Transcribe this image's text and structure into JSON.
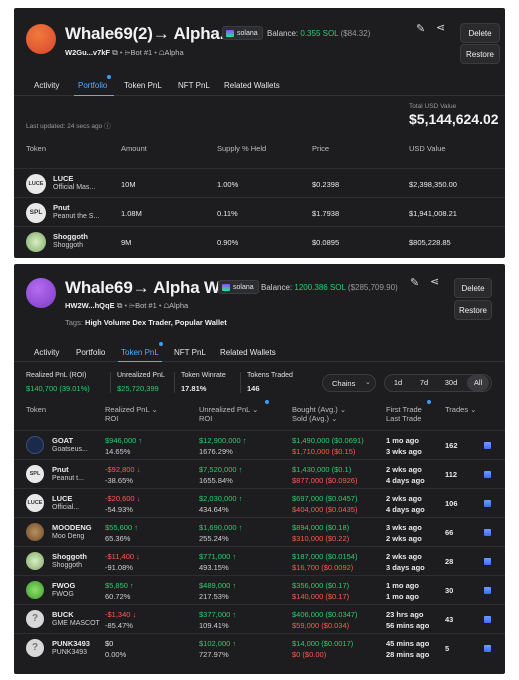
{
  "top": {
    "name": "Whale69(2)→ Alpha...",
    "chain": "solana",
    "balance_label": "Balance:",
    "balance_sol": "0.355 SOL",
    "balance_usd": "($84.32)",
    "address": "W2Gu...v7kF",
    "bot": "Bot #1",
    "group": "Alpha",
    "delete_label": "Delete",
    "restore_label": "Restore",
    "tabs": [
      "Activity",
      "Portfolio",
      "Token PnL",
      "NFT PnL",
      "Related Wallets"
    ],
    "last_updated": "Last updated: 24 secs ago",
    "total_label": "Total USD Value",
    "total_value": "$5,144,624.02",
    "headers": [
      "Token",
      "Amount",
      "Supply % Held",
      "Price",
      "USD Value"
    ],
    "rows": [
      {
        "icon": "LUCE",
        "symbol": "LUCE",
        "name": "Official Mas...",
        "amount": "10M",
        "supply": "1.00%",
        "price": "$0.2398",
        "usd": "$2,398,350.00"
      },
      {
        "icon": "SPL",
        "symbol": "Pnut",
        "name": "Peanut the S...",
        "amount": "1.08M",
        "supply": "0.11%",
        "price": "$1.7938",
        "usd": "$1,941,008.21"
      },
      {
        "icon": "shoggoth",
        "symbol": "Shoggoth",
        "name": "Shoggoth",
        "amount": "9M",
        "supply": "0.90%",
        "price": "$0.0895",
        "usd": "$805,228.85"
      }
    ]
  },
  "bottom": {
    "name": "Whale69→ Alpha W...",
    "chain": "solana",
    "balance_label": "Balance:",
    "balance_sol": "1200.386 SOL",
    "balance_usd": "($285,709.90)",
    "address": "HW2W...hQqE",
    "bot": "Bot #1",
    "group": "Alpha",
    "tags_label": "Tags:",
    "tags": "High Volume Dex Trader, Popular Wallet",
    "delete_label": "Delete",
    "restore_label": "Restore",
    "tabs": [
      "Activity",
      "Portfolio",
      "Token PnL",
      "NFT PnL",
      "Related Wallets"
    ],
    "stats": {
      "realized_label": "Realized PnL (ROI)",
      "realized_value": "$140,700 (39.01%)",
      "unrealized_label": "Unrealized PnL",
      "unrealized_value": "$25,720,399",
      "winrate_label": "Token Winrate",
      "winrate_value": "17.81%",
      "traded_label": "Tokens Traded",
      "traded_value": "146"
    },
    "chains_label": "Chains",
    "periods": [
      "1d",
      "7d",
      "30d",
      "All"
    ],
    "headers": {
      "token": "Token",
      "realized": "Realized PnL",
      "realized_sub": "ROI",
      "unrealized": "Unrealized PnL",
      "unrealized_sub": "ROI",
      "bought": "Bought (Avg.)",
      "sold": "Sold (Avg.)",
      "first": "First Trade",
      "last": "Last Trade",
      "trades": "Trades"
    },
    "rows": [
      {
        "icon": "goat",
        "symbol": "GOAT",
        "name": "Goatseus...",
        "rpnl": "$946,000",
        "rdir": "up",
        "roi": "14.65%",
        "upnl": "$12,900,000",
        "udir": "up",
        "uroi": "1676.29%",
        "bought": "$1,490,000 ($0.0691)",
        "sold": "$1,710,000 ($0.15)",
        "first": "1 mo ago",
        "last": "3 wks ago",
        "trades": "162"
      },
      {
        "icon": "SPL",
        "symbol": "Pnut",
        "name": "Peanut t...",
        "rpnl": "-$92,800",
        "rdir": "down",
        "roi": "-38.65%",
        "upnl": "$7,520,000",
        "udir": "up",
        "uroi": "1655.84%",
        "bought": "$1,430,000 ($0.1)",
        "sold": "$877,000 ($0.0926)",
        "first": "2 wks ago",
        "last": "4 days ago",
        "trades": "112"
      },
      {
        "icon": "LUCE",
        "symbol": "LUCE",
        "name": "Official...",
        "rpnl": "-$20,600",
        "rdir": "down",
        "roi": "-54.93%",
        "upnl": "$2,030,000",
        "udir": "up",
        "uroi": "434.64%",
        "bought": "$697,000 ($0.0457)",
        "sold": "$404,000 ($0.0435)",
        "first": "2 wks ago",
        "last": "4 days ago",
        "trades": "106"
      },
      {
        "icon": "moodeng",
        "symbol": "MOODENG",
        "name": "Moo Deng",
        "rpnl": "$55,600",
        "rdir": "up",
        "roi": "65.36%",
        "upnl": "$1,690,000",
        "udir": "up",
        "uroi": "255.24%",
        "bought": "$894,000 ($0.18)",
        "sold": "$310,000 ($0.22)",
        "first": "3 wks ago",
        "last": "2 wks ago",
        "trades": "66"
      },
      {
        "icon": "shoggoth",
        "symbol": "Shoggoth",
        "name": "Shoggoth",
        "rpnl": "-$11,400",
        "rdir": "down",
        "roi": "-91.08%",
        "upnl": "$771,000",
        "udir": "up",
        "uroi": "493.15%",
        "bought": "$187,000 ($0.0154)",
        "sold": "$16,700 ($0.0092)",
        "first": "2 wks ago",
        "last": "3 days ago",
        "trades": "28"
      },
      {
        "icon": "fwog",
        "symbol": "FWOG",
        "name": "FWOG",
        "rpnl": "$5,850",
        "rdir": "up",
        "roi": "60.72%",
        "upnl": "$489,000",
        "udir": "up",
        "uroi": "217.53%",
        "bought": "$356,000 ($0.17)",
        "sold": "$140,000 ($0.17)",
        "first": "1 mo ago",
        "last": "1 mo ago",
        "trades": "30"
      },
      {
        "icon": "unknown",
        "symbol": "BUCK",
        "name": "GME MASCOT",
        "rpnl": "-$1,340",
        "rdir": "down",
        "roi": "-85.47%",
        "upnl": "$377,000",
        "udir": "up",
        "uroi": "109.41%",
        "bought": "$406,000 ($0.0347)",
        "sold": "$59,000 ($0.034)",
        "first": "23 hrs ago",
        "last": "56 mins ago",
        "trades": "43"
      },
      {
        "icon": "unknown",
        "symbol": "PUNK3493",
        "name": "PUNK3493",
        "rpnl": "$0",
        "rdir": "none",
        "roi": "0.00%",
        "upnl": "$102,000",
        "udir": "up",
        "uroi": "727.97%",
        "bought": "$14,000 ($0.0017)",
        "sold": "$0 ($0.00)",
        "first": "45 mins ago",
        "last": "28 mins ago",
        "trades": "5"
      }
    ]
  },
  "colors": {
    "bg": "#1d1d1f",
    "positive": "#2ecc71",
    "negative": "#ff5a4f",
    "accent": "#5aa8ff"
  }
}
